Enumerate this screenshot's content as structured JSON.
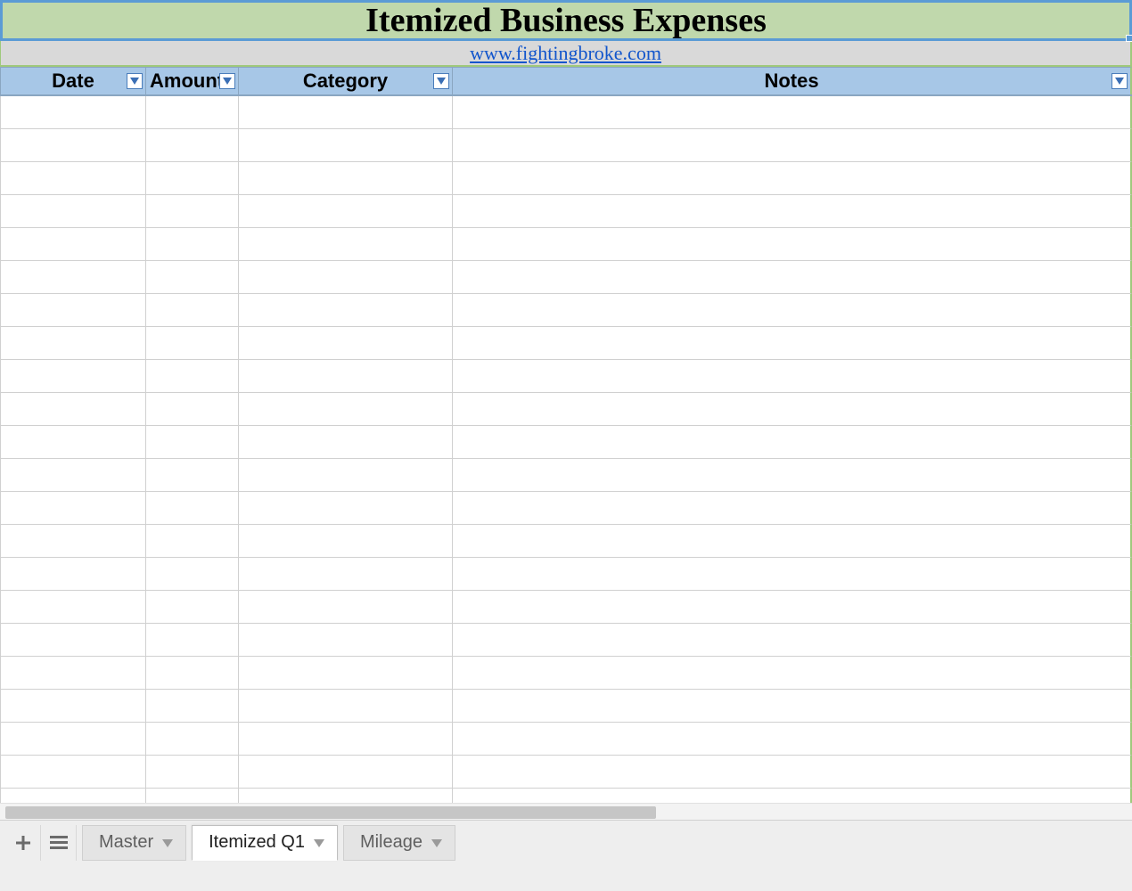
{
  "title": "Itemized Business Expenses",
  "link_text": "www.fightingbroke.com",
  "columns": {
    "date": "Date",
    "amount": "Amount",
    "category": "Category",
    "notes": "Notes"
  },
  "rows": [
    {
      "date": "",
      "amount": "",
      "category": "",
      "notes": ""
    },
    {
      "date": "",
      "amount": "",
      "category": "",
      "notes": ""
    },
    {
      "date": "",
      "amount": "",
      "category": "",
      "notes": ""
    },
    {
      "date": "",
      "amount": "",
      "category": "",
      "notes": ""
    },
    {
      "date": "",
      "amount": "",
      "category": "",
      "notes": ""
    },
    {
      "date": "",
      "amount": "",
      "category": "",
      "notes": ""
    },
    {
      "date": "",
      "amount": "",
      "category": "",
      "notes": ""
    },
    {
      "date": "",
      "amount": "",
      "category": "",
      "notes": ""
    },
    {
      "date": "",
      "amount": "",
      "category": "",
      "notes": ""
    },
    {
      "date": "",
      "amount": "",
      "category": "",
      "notes": ""
    },
    {
      "date": "",
      "amount": "",
      "category": "",
      "notes": ""
    },
    {
      "date": "",
      "amount": "",
      "category": "",
      "notes": ""
    },
    {
      "date": "",
      "amount": "",
      "category": "",
      "notes": ""
    },
    {
      "date": "",
      "amount": "",
      "category": "",
      "notes": ""
    },
    {
      "date": "",
      "amount": "",
      "category": "",
      "notes": ""
    },
    {
      "date": "",
      "amount": "",
      "category": "",
      "notes": ""
    },
    {
      "date": "",
      "amount": "",
      "category": "",
      "notes": ""
    },
    {
      "date": "",
      "amount": "",
      "category": "",
      "notes": ""
    },
    {
      "date": "",
      "amount": "",
      "category": "",
      "notes": ""
    },
    {
      "date": "",
      "amount": "",
      "category": "",
      "notes": ""
    },
    {
      "date": "",
      "amount": "",
      "category": "",
      "notes": ""
    },
    {
      "date": "",
      "amount": "",
      "category": "",
      "notes": ""
    }
  ],
  "tabs": [
    {
      "label": "Master",
      "active": false
    },
    {
      "label": "Itemized Q1",
      "active": true
    },
    {
      "label": "Mileage",
      "active": false
    }
  ],
  "colors": {
    "title_bg": "#c0d8ac",
    "title_border": "#5b9bd5",
    "header_bg": "#a7c7e7",
    "link_bg": "#d9d9d9",
    "green_border": "#9fc97c"
  }
}
